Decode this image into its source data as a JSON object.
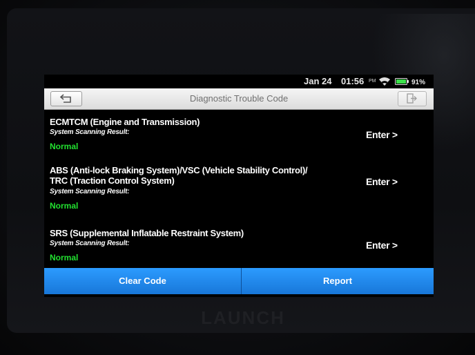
{
  "status_bar": {
    "date": "Jan 24",
    "time": "01:56",
    "ampm": "PM",
    "battery": "91%",
    "icons": [
      "wifi-icon",
      "battery-icon"
    ]
  },
  "header": {
    "title": "Diagnostic Trouble Code",
    "back_icon": "back-arrow-icon",
    "exit_icon": "exit-icon"
  },
  "systems": [
    {
      "name": "ECMTCM (Engine and Transmission)",
      "result_label": "System Scanning Result:",
      "result": "Normal",
      "action": "Enter >"
    },
    {
      "name": "ABS (Anti-lock Braking System)/VSC (Vehicle Stability Control)/\nTRC (Traction Control System)",
      "result_label": "System Scanning Result:",
      "result": "Normal",
      "action": "Enter >"
    },
    {
      "name": "SRS (Supplemental Inflatable Restraint System)",
      "result_label": "System Scanning Result:",
      "result": "Normal",
      "action": "Enter >"
    }
  ],
  "actions": {
    "clear": "Clear Code",
    "report": "Report"
  },
  "colors": {
    "accent": "#1b86e8",
    "normal": "#22e030",
    "background": "#000000"
  }
}
